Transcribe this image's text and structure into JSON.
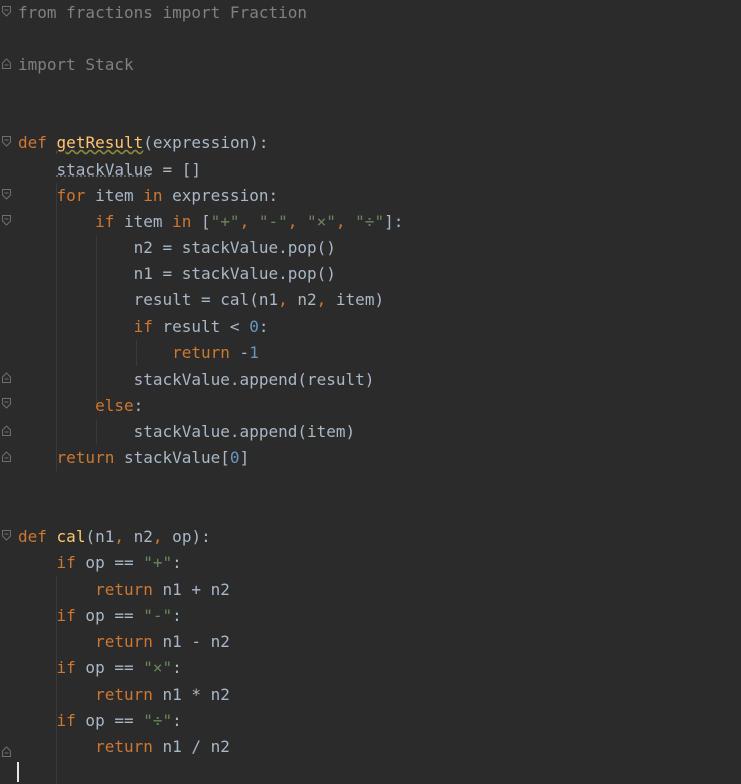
{
  "editor": {
    "lines": [
      {
        "tokens": [
          {
            "t": "from",
            "c": "dim"
          },
          {
            "t": " fractions ",
            "c": "dim"
          },
          {
            "t": "import",
            "c": "dim"
          },
          {
            "t": " Fraction",
            "c": "dim"
          }
        ]
      },
      {
        "tokens": [
          {
            "t": "import",
            "c": "dim"
          },
          {
            "t": " Stack",
            "c": "dim"
          }
        ]
      },
      {
        "tokens": [
          {
            "t": "def",
            "c": "kw"
          },
          {
            "t": " ",
            "c": ""
          },
          {
            "t": "getResult",
            "c": "fn warn"
          },
          {
            "t": "(expression):",
            "c": ""
          }
        ]
      },
      {
        "tokens": [
          {
            "t": "    ",
            "c": ""
          },
          {
            "t": "stackValue",
            "c": "weak"
          },
          {
            "t": " = []",
            "c": ""
          }
        ]
      },
      {
        "tokens": [
          {
            "t": "    ",
            "c": ""
          },
          {
            "t": "for",
            "c": "kw"
          },
          {
            "t": " item ",
            "c": ""
          },
          {
            "t": "in",
            "c": "kw"
          },
          {
            "t": " expression:",
            "c": ""
          }
        ]
      },
      {
        "tokens": [
          {
            "t": "        ",
            "c": ""
          },
          {
            "t": "if",
            "c": "kw"
          },
          {
            "t": " item ",
            "c": ""
          },
          {
            "t": "in",
            "c": "kw"
          },
          {
            "t": " [",
            "c": ""
          },
          {
            "t": "\"+\"",
            "c": "str"
          },
          {
            "t": ", ",
            "c": "kw"
          },
          {
            "t": "\"-\"",
            "c": "str"
          },
          {
            "t": ", ",
            "c": "kw"
          },
          {
            "t": "\"×\"",
            "c": "str"
          },
          {
            "t": ", ",
            "c": "kw"
          },
          {
            "t": "\"÷\"",
            "c": "str"
          },
          {
            "t": "]:",
            "c": ""
          }
        ]
      },
      {
        "tokens": [
          {
            "t": "            n2 = stackValue.pop()",
            "c": ""
          }
        ]
      },
      {
        "tokens": [
          {
            "t": "            n1 = stackValue.pop()",
            "c": ""
          }
        ]
      },
      {
        "tokens": [
          {
            "t": "            result = cal(n1",
            "c": ""
          },
          {
            "t": ",",
            "c": "kw"
          },
          {
            "t": " n2",
            "c": ""
          },
          {
            "t": ",",
            "c": "kw"
          },
          {
            "t": " item)",
            "c": ""
          }
        ]
      },
      {
        "tokens": [
          {
            "t": "            ",
            "c": ""
          },
          {
            "t": "if",
            "c": "kw"
          },
          {
            "t": " result < ",
            "c": ""
          },
          {
            "t": "0",
            "c": "num"
          },
          {
            "t": ":",
            "c": ""
          }
        ]
      },
      {
        "tokens": [
          {
            "t": "                ",
            "c": ""
          },
          {
            "t": "return",
            "c": "kw"
          },
          {
            "t": " -",
            "c": ""
          },
          {
            "t": "1",
            "c": "num"
          }
        ]
      },
      {
        "tokens": [
          {
            "t": "            stackValue.append(result)",
            "c": ""
          }
        ]
      },
      {
        "tokens": [
          {
            "t": "        ",
            "c": ""
          },
          {
            "t": "else",
            "c": "kw"
          },
          {
            "t": ":",
            "c": ""
          }
        ]
      },
      {
        "tokens": [
          {
            "t": "            stackValue.append(item)",
            "c": ""
          }
        ]
      },
      {
        "tokens": [
          {
            "t": "    ",
            "c": ""
          },
          {
            "t": "return",
            "c": "kw"
          },
          {
            "t": " stackValue[",
            "c": ""
          },
          {
            "t": "0",
            "c": "num"
          },
          {
            "t": "]",
            "c": ""
          }
        ]
      },
      {
        "tokens": [
          {
            "t": "def",
            "c": "kw"
          },
          {
            "t": " ",
            "c": ""
          },
          {
            "t": "cal",
            "c": "fn"
          },
          {
            "t": "(n1",
            "c": ""
          },
          {
            "t": ",",
            "c": "kw"
          },
          {
            "t": " n2",
            "c": ""
          },
          {
            "t": ",",
            "c": "kw"
          },
          {
            "t": " op):",
            "c": ""
          }
        ]
      },
      {
        "tokens": [
          {
            "t": "    ",
            "c": ""
          },
          {
            "t": "if",
            "c": "kw"
          },
          {
            "t": " op == ",
            "c": ""
          },
          {
            "t": "\"+\"",
            "c": "str"
          },
          {
            "t": ":",
            "c": ""
          }
        ]
      },
      {
        "tokens": [
          {
            "t": "        ",
            "c": ""
          },
          {
            "t": "return",
            "c": "kw"
          },
          {
            "t": " n1 + n2",
            "c": ""
          }
        ]
      },
      {
        "tokens": [
          {
            "t": "    ",
            "c": ""
          },
          {
            "t": "if",
            "c": "kw"
          },
          {
            "t": " op == ",
            "c": ""
          },
          {
            "t": "\"-\"",
            "c": "str"
          },
          {
            "t": ":",
            "c": ""
          }
        ]
      },
      {
        "tokens": [
          {
            "t": "        ",
            "c": ""
          },
          {
            "t": "return",
            "c": "kw"
          },
          {
            "t": " n1 - n2",
            "c": ""
          }
        ]
      },
      {
        "tokens": [
          {
            "t": "    ",
            "c": ""
          },
          {
            "t": "if",
            "c": "kw"
          },
          {
            "t": " op == ",
            "c": ""
          },
          {
            "t": "\"×\"",
            "c": "str"
          },
          {
            "t": ":",
            "c": ""
          }
        ]
      },
      {
        "tokens": [
          {
            "t": "        ",
            "c": ""
          },
          {
            "t": "return",
            "c": "kw"
          },
          {
            "t": " n1 * n2",
            "c": ""
          }
        ]
      },
      {
        "tokens": [
          {
            "t": "    ",
            "c": ""
          },
          {
            "t": "if",
            "c": "kw"
          },
          {
            "t": " op == ",
            "c": ""
          },
          {
            "t": "\"÷\"",
            "c": "str"
          },
          {
            "t": ":",
            "c": ""
          }
        ]
      },
      {
        "tokens": [
          {
            "t": "        ",
            "c": ""
          },
          {
            "t": "return",
            "c": "kw"
          },
          {
            "t": " n1 / n2",
            "c": ""
          }
        ]
      }
    ]
  },
  "colors": {
    "background": "#2b2b2b",
    "text": "#a9b7c6",
    "keyword": "#cc7832",
    "function": "#ffc66d",
    "string": "#6a8759",
    "number": "#6897bb",
    "unused_import": "#808080"
  },
  "icons": [
    "fold-open-icon",
    "fold-end-icon",
    "text-caret"
  ]
}
